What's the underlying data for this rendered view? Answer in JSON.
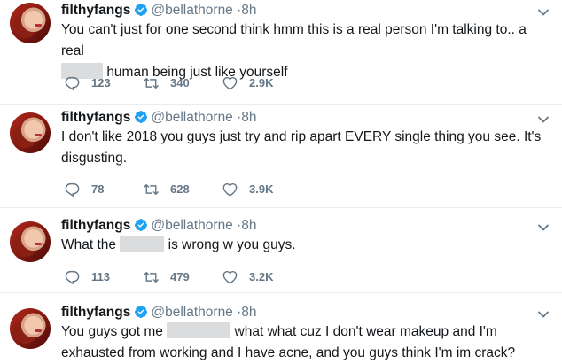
{
  "tweets": [
    {
      "name": "filthyfangs",
      "handle": "@bellathorne",
      "time": "8h",
      "text_parts": [
        "You can't just for one second think hmm this is a real person I'm talking to.. a real",
        "human being just like yourself"
      ],
      "replies": "123",
      "retweets": "340",
      "likes": "2.9K"
    },
    {
      "name": "filthyfangs",
      "handle": "@bellathorne",
      "time": "8h",
      "text_parts": [
        "I don't like 2018 you guys just try and rip apart EVERY single thing you see. It's disgusting."
      ],
      "replies": "78",
      "retweets": "628",
      "likes": "3.9K"
    },
    {
      "name": "filthyfangs",
      "handle": "@bellathorne",
      "time": "8h",
      "text_parts": [
        "What the",
        "is wrong w you guys."
      ],
      "replies": "113",
      "retweets": "479",
      "likes": "3.2K"
    },
    {
      "name": "filthyfangs",
      "handle": "@bellathorne",
      "time": "8h",
      "text_parts": [
        "You guys got me",
        "what what cuz I don't wear makeup and I'm exhausted from working and I have acne, and you guys think I'm im crack?"
      ]
    }
  ],
  "colors": {
    "verified": "#1da1f2",
    "muted": "#657786",
    "divider": "#e6ecf0",
    "redaction": "#dadcdd"
  },
  "icons": {
    "reply": "reply-icon",
    "retweet": "retweet-icon",
    "like": "heart-icon",
    "menu": "chevron-down-icon",
    "verified": "verified-badge-icon"
  }
}
